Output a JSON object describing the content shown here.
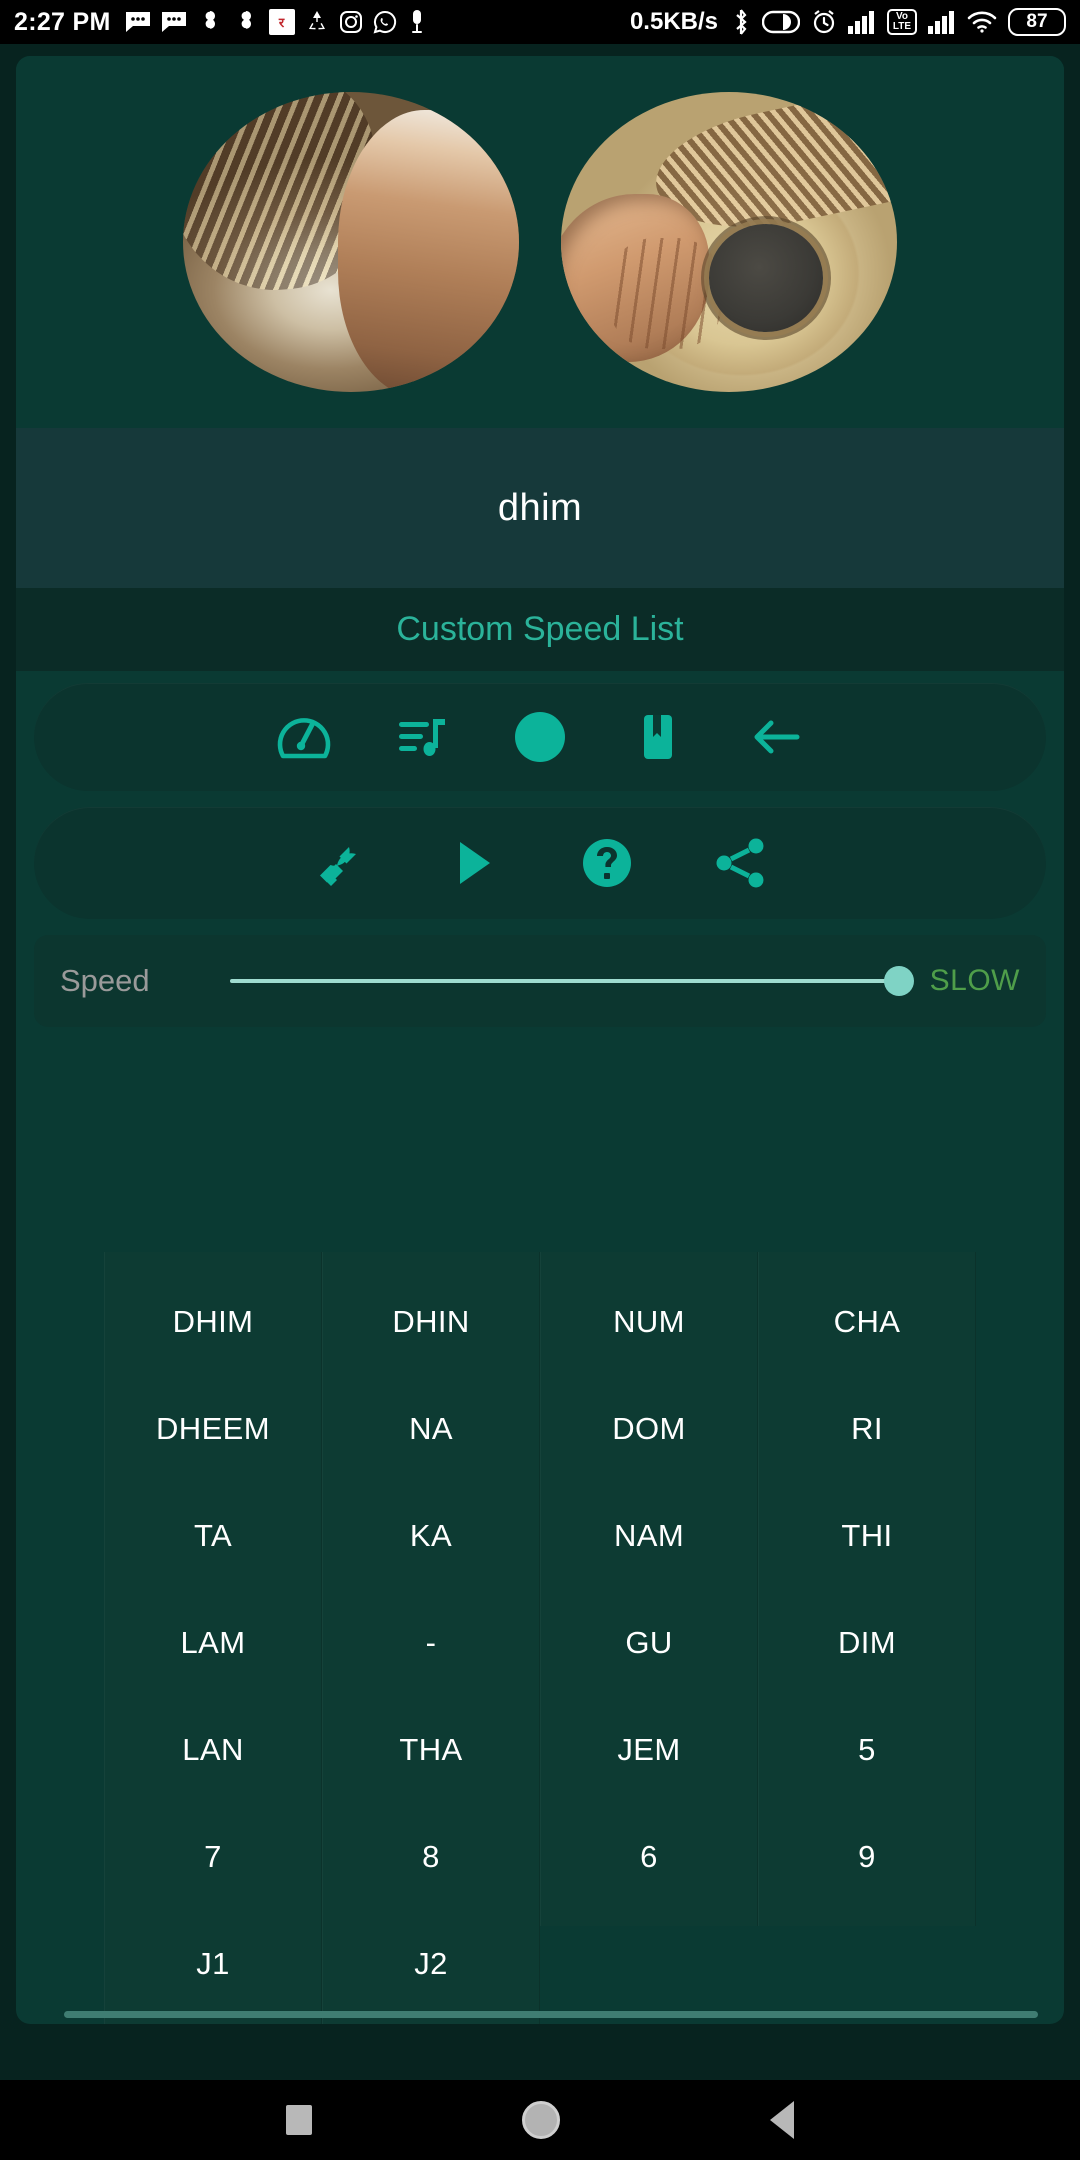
{
  "statusbar": {
    "time": "2:27 PM",
    "network_speed": "0.5KB/s",
    "battery": "87",
    "volte_top": "Vo",
    "volte_bottom": "LTE",
    "irctc_label": "र",
    "left_icons": [
      "message-icon",
      "message-icon",
      "puzzle-icon",
      "puzzle-icon",
      "irctc-app-icon",
      "recycle-app-icon",
      "instagram-icon",
      "whatsapp-icon",
      "microphone-icon"
    ],
    "right_icons": [
      "bluetooth-icon",
      "do-not-disturb-icon",
      "alarm-icon",
      "signal-bars-icon",
      "volte-icon",
      "signal-bars-2-icon",
      "wifi-icon",
      "battery-icon"
    ]
  },
  "header": {
    "images": [
      {
        "name": "mridangam-photo",
        "alt": "hand playing mridangam drum head"
      },
      {
        "name": "kanjira-photo",
        "alt": "hand playing framed drum with dark center"
      }
    ]
  },
  "bol_display": {
    "current_bol": "dhim"
  },
  "title_band": {
    "title": "Custom Speed List"
  },
  "toolbar_row1": {
    "buttons": [
      {
        "name": "speed-gauge-button",
        "icon": "speedometer-icon",
        "label": "Speed"
      },
      {
        "name": "playlist-button",
        "icon": "playlist-music-icon",
        "label": "Playlist"
      },
      {
        "name": "record-button",
        "icon": "record-circle-icon",
        "label": "Record"
      },
      {
        "name": "bookmark-button",
        "icon": "bookmark-icon",
        "label": "Bookmark"
      },
      {
        "name": "back-button",
        "icon": "arrow-left-icon",
        "label": "Back"
      }
    ]
  },
  "toolbar_row2": {
    "buttons": [
      {
        "name": "settings-button",
        "icon": "wrench-icon",
        "label": "Settings"
      },
      {
        "name": "play-button",
        "icon": "play-icon",
        "label": "Play"
      },
      {
        "name": "help-button",
        "icon": "help-circle-icon",
        "label": "Help"
      },
      {
        "name": "share-button",
        "icon": "share-icon",
        "label": "Share"
      }
    ]
  },
  "speed_control": {
    "label": "Speed",
    "value_label": "SLOW",
    "slider_percent": 100
  },
  "bol_grid": {
    "columns": [
      {
        "name": "column-1",
        "cells": [
          "DHIM",
          "DHEEM",
          "TA",
          "LAM",
          "LAN",
          "7",
          "J1"
        ]
      },
      {
        "name": "column-2",
        "cells": [
          "DHIN",
          "NA",
          "KA",
          "-",
          "THA",
          "8",
          "J2"
        ]
      },
      {
        "name": "column-3",
        "cells": [
          "NUM",
          "DOM",
          "NAM",
          "GU",
          "JEM",
          "6"
        ]
      },
      {
        "name": "column-4",
        "cells": [
          "CHA",
          "RI",
          "THI",
          "DIM",
          "5",
          "9"
        ]
      }
    ]
  },
  "navbar": {
    "buttons": [
      {
        "name": "nav-recents-button",
        "icon": "square-icon"
      },
      {
        "name": "nav-home-button",
        "icon": "circle-icon"
      },
      {
        "name": "nav-back-button",
        "icon": "triangle-left-icon"
      }
    ]
  },
  "colors": {
    "accent": "#0cb39a",
    "background": "#0a3a33",
    "title_text": "#2bb39a",
    "speed_value": "#4f9e4a",
    "slider_thumb": "#7fd3c5"
  }
}
